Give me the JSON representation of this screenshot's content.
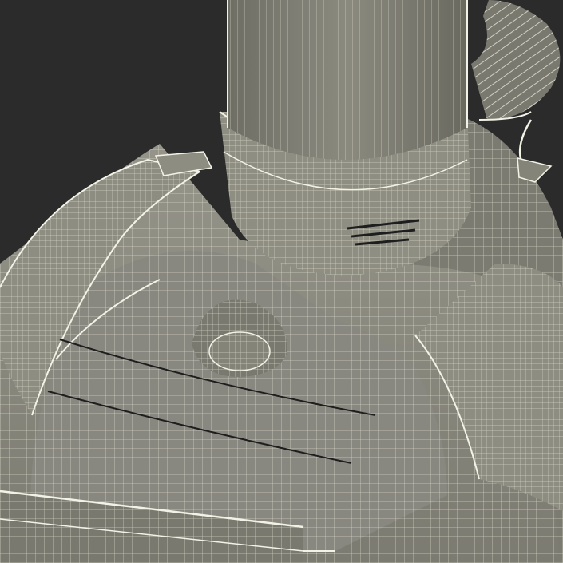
{
  "scene": {
    "subject": "vacuum-cleaner-wireframe",
    "colors": {
      "background": "#2b2b2b",
      "surface": "#858479",
      "surface_light": "#96958a",
      "surface_dark": "#5e5d55",
      "wire": "#e7e6d6",
      "edge": "#f3f2e6",
      "slot": "#1e1e1e"
    }
  }
}
